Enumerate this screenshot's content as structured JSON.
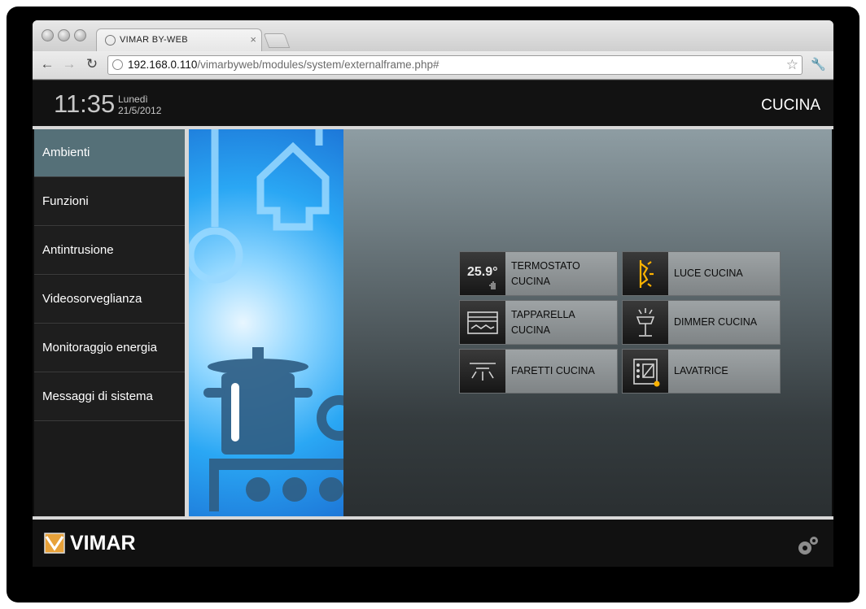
{
  "browser": {
    "tab_title": "VIMAR BY-WEB",
    "tab_close": "×",
    "url_host": "192.168.0.110",
    "url_path": "/vimarbyweb/modules/system/externalframe.php#",
    "back": "←",
    "forward": "→",
    "reload": "↻",
    "star": "☆",
    "wrench": "🔧"
  },
  "header": {
    "time": "11:35",
    "day": "Lunedì",
    "date": "21/5/2012",
    "room": "CUCINA"
  },
  "sidebar": {
    "items": [
      {
        "label": "Ambienti",
        "active": true
      },
      {
        "label": "Funzioni"
      },
      {
        "label": "Antintrusione"
      },
      {
        "label": "Videosorveglianza"
      },
      {
        "label": "Monitoraggio energia"
      },
      {
        "label": "Messaggi di sistema"
      }
    ]
  },
  "devices": [
    {
      "line1": "TERMOSTATO",
      "line2": "CUCINA",
      "icon": "thermostat-icon",
      "value": "25.9°"
    },
    {
      "line1": "LUCE CUCINA",
      "icon": "light-bulb-icon"
    },
    {
      "line1": "TAPPARELLA",
      "line2": "CUCINA",
      "icon": "shutter-icon"
    },
    {
      "line1": "DIMMER CUCINA",
      "icon": "dimmer-lamp-icon"
    },
    {
      "line1": "FARETTI CUCINA",
      "icon": "spotlight-icon"
    },
    {
      "line1": "LAVATRICE",
      "icon": "washing-machine-icon"
    }
  ],
  "footer": {
    "brand": "VIMAR"
  },
  "colors": {
    "sidebar_active": "#557078",
    "light_on": "#ffb300"
  }
}
